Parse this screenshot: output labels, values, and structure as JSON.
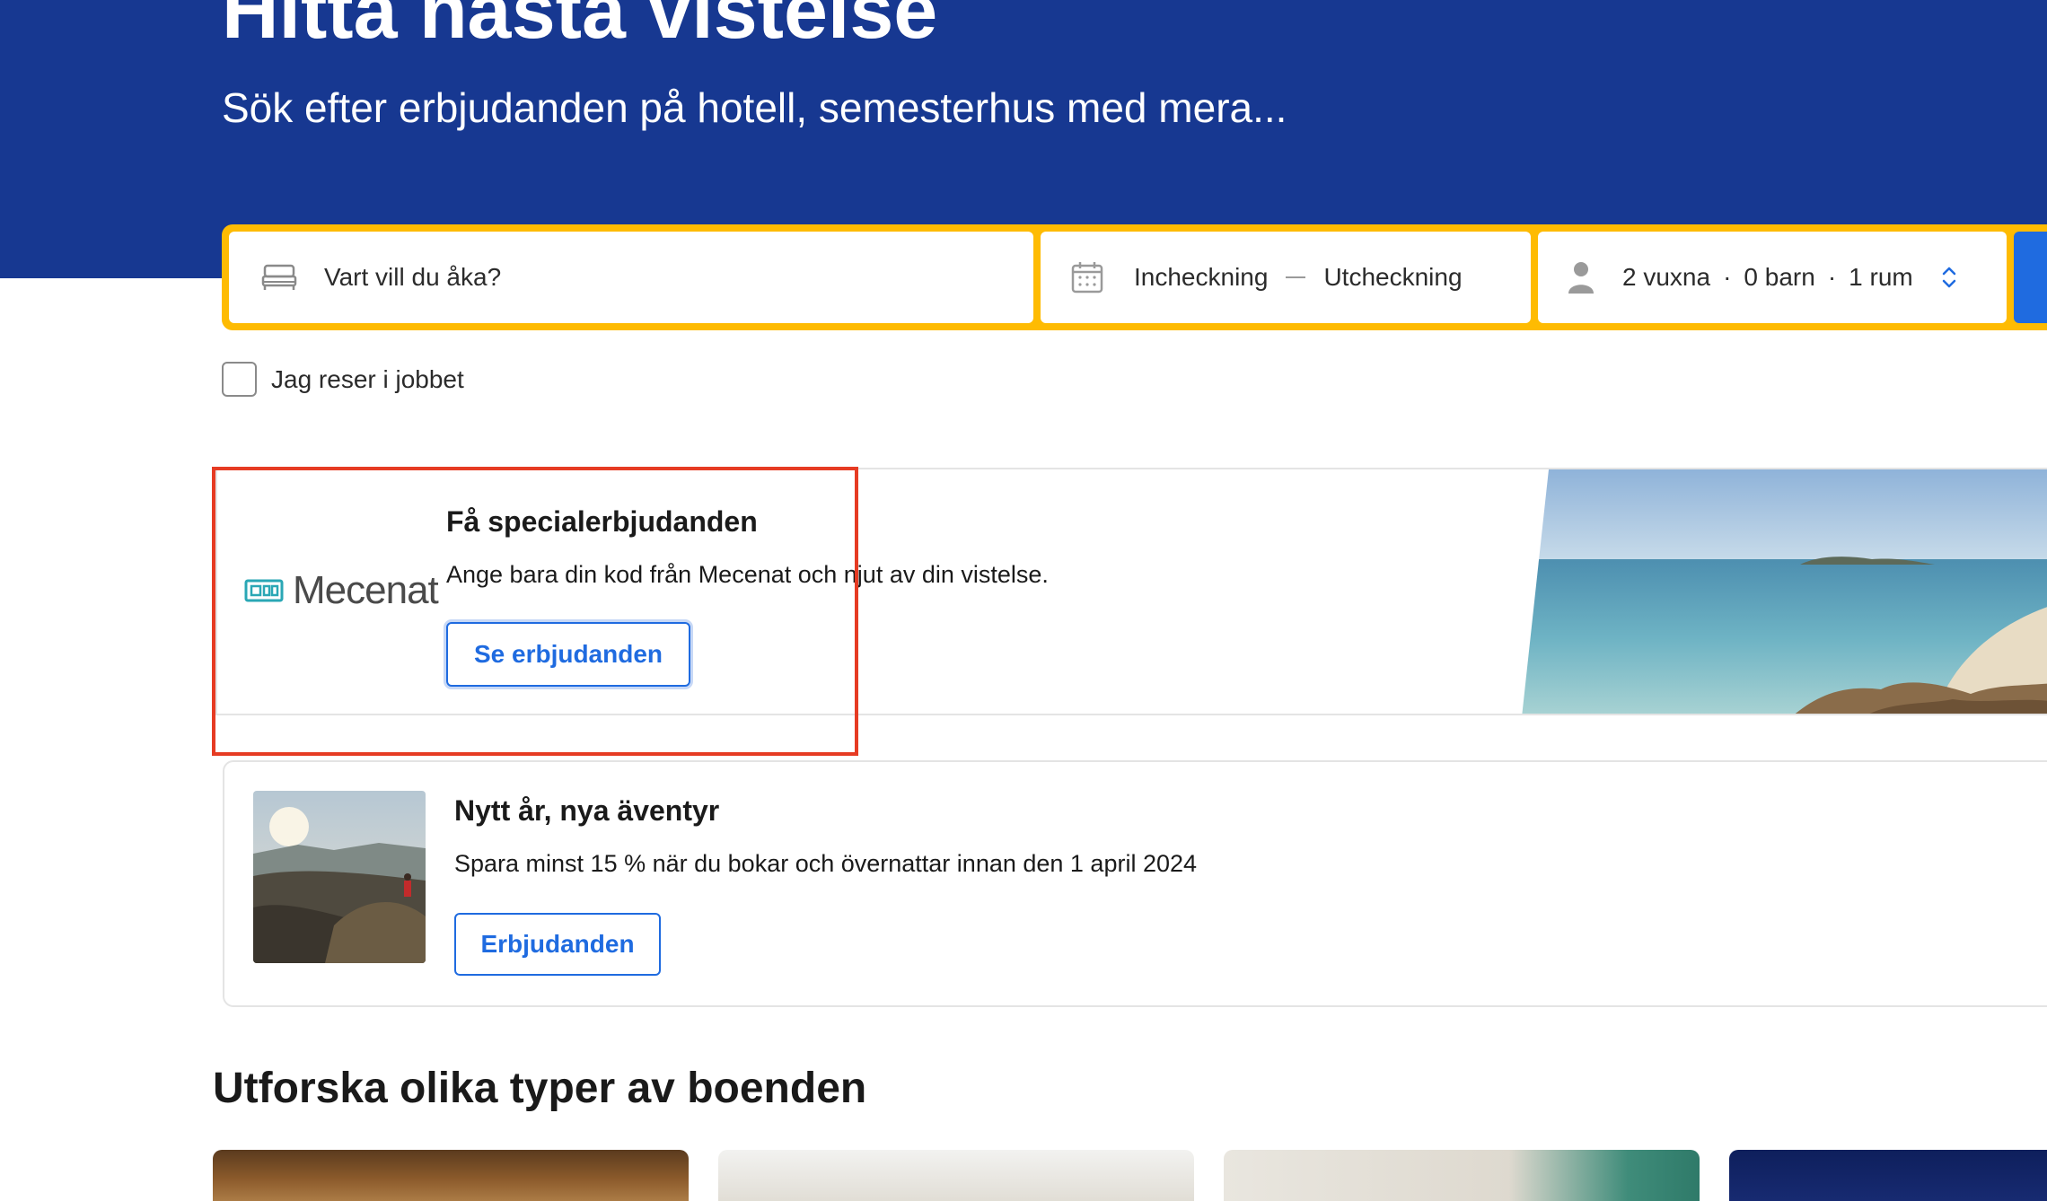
{
  "hero": {
    "title": "Hitta nästa vistelse",
    "subtitle": "Sök efter erbjudanden på hotell, semesterhus med mera..."
  },
  "search": {
    "destination_placeholder": "Vart vill du åka?",
    "checkin_label": "Incheckning",
    "checkout_label": "Utcheckning",
    "adults": "2 vuxna",
    "children": "0 barn",
    "rooms": "1 rum",
    "separator": "·",
    "icons": {
      "destination": "bed-icon",
      "dates": "calendar-icon",
      "guests": "person-icon",
      "guests_toggle": "chevron-updown-icon"
    }
  },
  "work_travel": {
    "label": "Jag reser i jobbet",
    "checked": false
  },
  "mecenat_offer": {
    "logo_text": "Mecenat",
    "title": "Få specialerbjudanden",
    "description": "Ange bara din kod från Mecenat och njut av din vistelse.",
    "button_label": "Se erbjudanden"
  },
  "new_year_offer": {
    "title": "Nytt år, nya äventyr",
    "description": "Spara minst 15 % när du bokar och övernattar innan den 1 april 2024",
    "button_label": "Erbjudanden"
  },
  "explore": {
    "heading": "Utforska olika typer av boenden"
  },
  "colors": {
    "hero_blue": "#173891",
    "search_border": "#febb02",
    "accent_blue": "#1f6be0",
    "annotation_red": "#e63b23"
  }
}
